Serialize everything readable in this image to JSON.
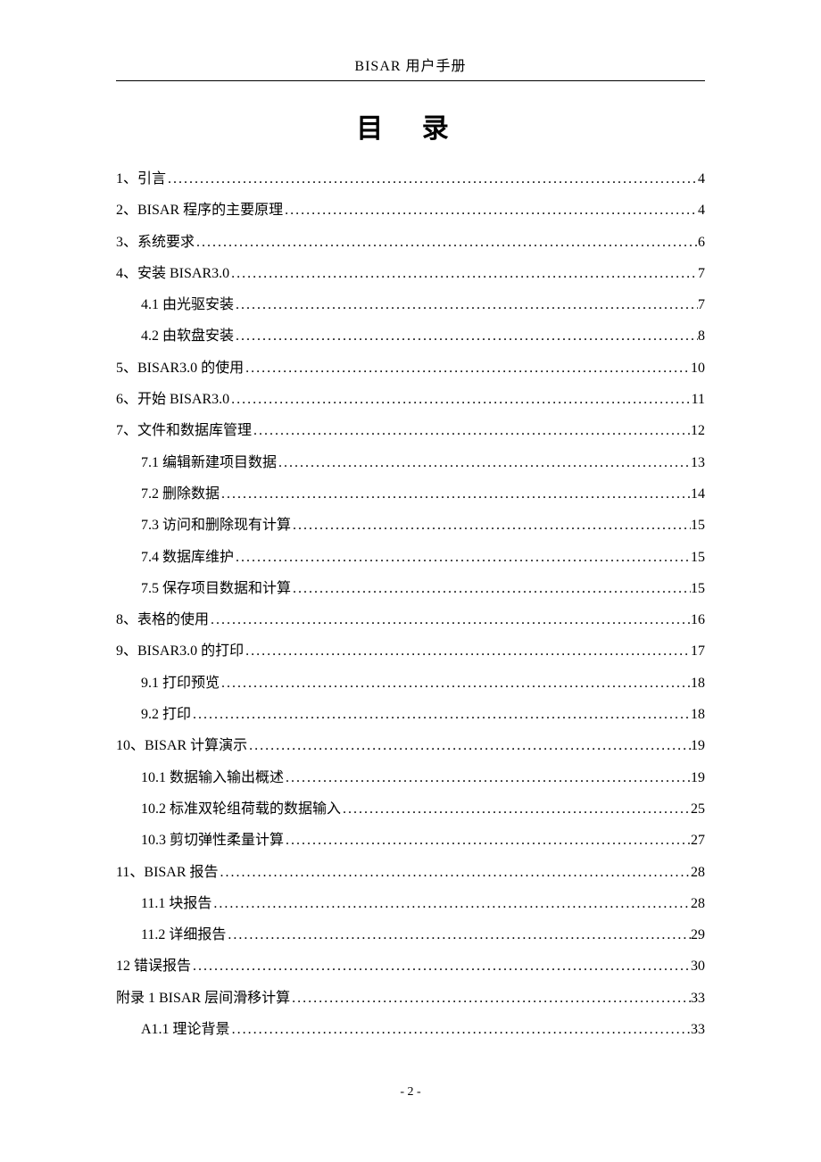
{
  "header": {
    "running_head": "BISAR 用户手册",
    "title": "目  录"
  },
  "toc": [
    {
      "label": "1、引言",
      "page": "4",
      "level": 1
    },
    {
      "label": "2、BISAR 程序的主要原理",
      "page": "4",
      "level": 1
    },
    {
      "label": "3、系统要求",
      "page": "6",
      "level": 1
    },
    {
      "label": "4、安装 BISAR3.0",
      "page": "7",
      "level": 1
    },
    {
      "label": "4.1 由光驱安装",
      "page": "7",
      "level": 2
    },
    {
      "label": "4.2 由软盘安装",
      "page": "8",
      "level": 2
    },
    {
      "label": "5、BISAR3.0 的使用",
      "page": "10",
      "level": 1
    },
    {
      "label": "6、开始 BISAR3.0",
      "page": "11",
      "level": 1
    },
    {
      "label": "7、文件和数据库管理",
      "page": "12",
      "level": 1
    },
    {
      "label": "7.1 编辑新建项目数据",
      "page": "13",
      "level": 2
    },
    {
      "label": "7.2 删除数据",
      "page": "14",
      "level": 2
    },
    {
      "label": "7.3 访问和删除现有计算",
      "page": "15",
      "level": 2
    },
    {
      "label": "7.4 数据库维护",
      "page": "15",
      "level": 2
    },
    {
      "label": "7.5 保存项目数据和计算",
      "page": "15",
      "level": 2
    },
    {
      "label": "8、表格的使用",
      "page": "16",
      "level": 1
    },
    {
      "label": "9、BISAR3.0 的打印",
      "page": "17",
      "level": 1
    },
    {
      "label": "9.1 打印预览",
      "page": "18",
      "level": 2
    },
    {
      "label": "9.2 打印",
      "page": "18",
      "level": 2
    },
    {
      "label": "10、BISAR 计算演示",
      "page": "19",
      "level": 1
    },
    {
      "label": "10.1 数据输入输出概述",
      "page": "19",
      "level": 2
    },
    {
      "label": "10.2 标准双轮组荷载的数据输入",
      "page": "25",
      "level": 2
    },
    {
      "label": "10.3 剪切弹性柔量计算",
      "page": "27",
      "level": 2
    },
    {
      "label": "11、BISAR 报告",
      "page": "28",
      "level": 1
    },
    {
      "label": "11.1 块报告",
      "page": "28",
      "level": 2
    },
    {
      "label": "11.2 详细报告",
      "page": "29",
      "level": 2
    },
    {
      "label": "12 错误报告",
      "page": "30",
      "level": 1
    },
    {
      "label": "附录 1 BISAR 层间滑移计算",
      "page": "33",
      "level": 1
    },
    {
      "label": "A1.1 理论背景",
      "page": "33",
      "level": 2
    }
  ],
  "footer": {
    "page_number": "- 2 -"
  }
}
